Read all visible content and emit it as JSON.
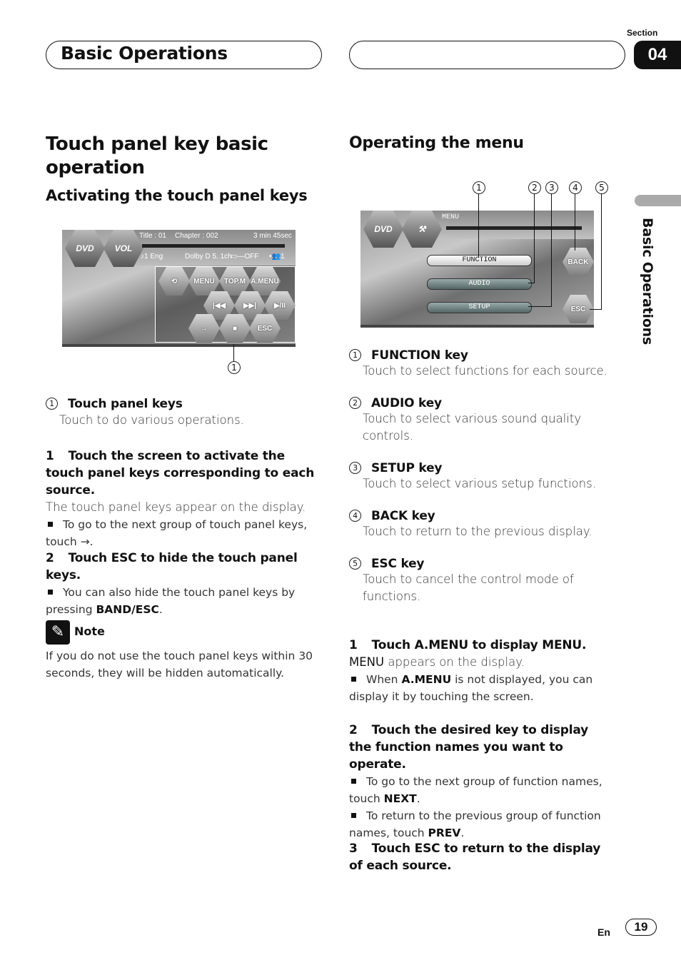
{
  "header": {
    "chapter_title": "Basic Operations",
    "section_label": "Section",
    "section_number": "04"
  },
  "side_tab": {
    "label": "Basic Operations"
  },
  "left": {
    "title": "Touch panel key basic operation",
    "subtitle": "Activating the touch panel keys",
    "screen": {
      "info_line1": {
        "title": "Title : 01",
        "chapter": "Chapter : 002",
        "time": "3 min 45sec"
      },
      "info_line2": {
        "audio": "♪1 Eng",
        "format": "Dolby D 5. 1ch",
        "subtitle": "▭—OFF",
        "angle": "•👥1"
      },
      "logo_dvd": "DVD",
      "logo_vol": "VOL",
      "keys": [
        "⟲",
        "MENU",
        "TOP.M",
        "A.MENU",
        "|◀◀",
        "▶▶|",
        "▶/II",
        "→",
        "■",
        "ESC"
      ]
    },
    "callout": "1",
    "legend": [
      {
        "num": "1",
        "title": "Touch panel keys",
        "desc": "Touch to do various operations."
      }
    ],
    "steps": [
      {
        "num": "1",
        "title": "Touch the screen to activate the touch panel keys corresponding to each source.",
        "body": "The touch panel keys appear on the display.",
        "bullets": [
          {
            "text": "To go to the next group of touch panel keys, touch",
            "suffix": " →."
          }
        ]
      },
      {
        "num": "2",
        "title": "Touch ESC to hide the touch panel keys.",
        "bullets": [
          {
            "text": "You can also hide the touch panel keys by pressing ",
            "bold": "BAND/ESC",
            "suffix": "."
          }
        ]
      }
    ],
    "note": {
      "label": "Note",
      "text": "If you do not use the touch panel keys within 30 seconds, they will be hidden automatically."
    }
  },
  "right": {
    "title": "Operating the menu",
    "screen": {
      "menu_label": "MENU",
      "logo_dvd": "DVD",
      "keys": {
        "function": "FUNCTION",
        "audio": "AUDIO",
        "setup": "SETUP",
        "back": "BACK",
        "esc": "ESC"
      }
    },
    "callouts": [
      "1",
      "2",
      "3",
      "4",
      "5"
    ],
    "legend": [
      {
        "num": "1",
        "title": "FUNCTION key",
        "desc": "Touch to select functions for each source."
      },
      {
        "num": "2",
        "title": "AUDIO key",
        "desc": "Touch to select various sound quality controls."
      },
      {
        "num": "3",
        "title": "SETUP key",
        "desc": "Touch to select various setup functions."
      },
      {
        "num": "4",
        "title": "BACK key",
        "desc": "Touch to return to the previous display."
      },
      {
        "num": "5",
        "title": "ESC key",
        "desc": "Touch to cancel the control mode of functions."
      }
    ],
    "steps": [
      {
        "num": "1",
        "title": "Touch A.MENU to display MENU.",
        "body_bold": "MENU",
        "body": " appears on the display.",
        "bullets": [
          {
            "text": "When ",
            "bold": "A.MENU",
            "suffix": " is not displayed, you can display it by touching the screen."
          }
        ]
      },
      {
        "num": "2",
        "title": "Touch the desired key to display the function names you want to operate.",
        "bullets": [
          {
            "text": "To go to the next group of function names, touch ",
            "bold": "NEXT",
            "suffix": "."
          },
          {
            "text": "To return to the previous group of function names, touch ",
            "bold": "PREV",
            "suffix": "."
          }
        ]
      },
      {
        "num": "3",
        "title": "Touch ESC to return to the display of each source."
      }
    ]
  },
  "footer": {
    "lang": "En",
    "page": "19"
  }
}
